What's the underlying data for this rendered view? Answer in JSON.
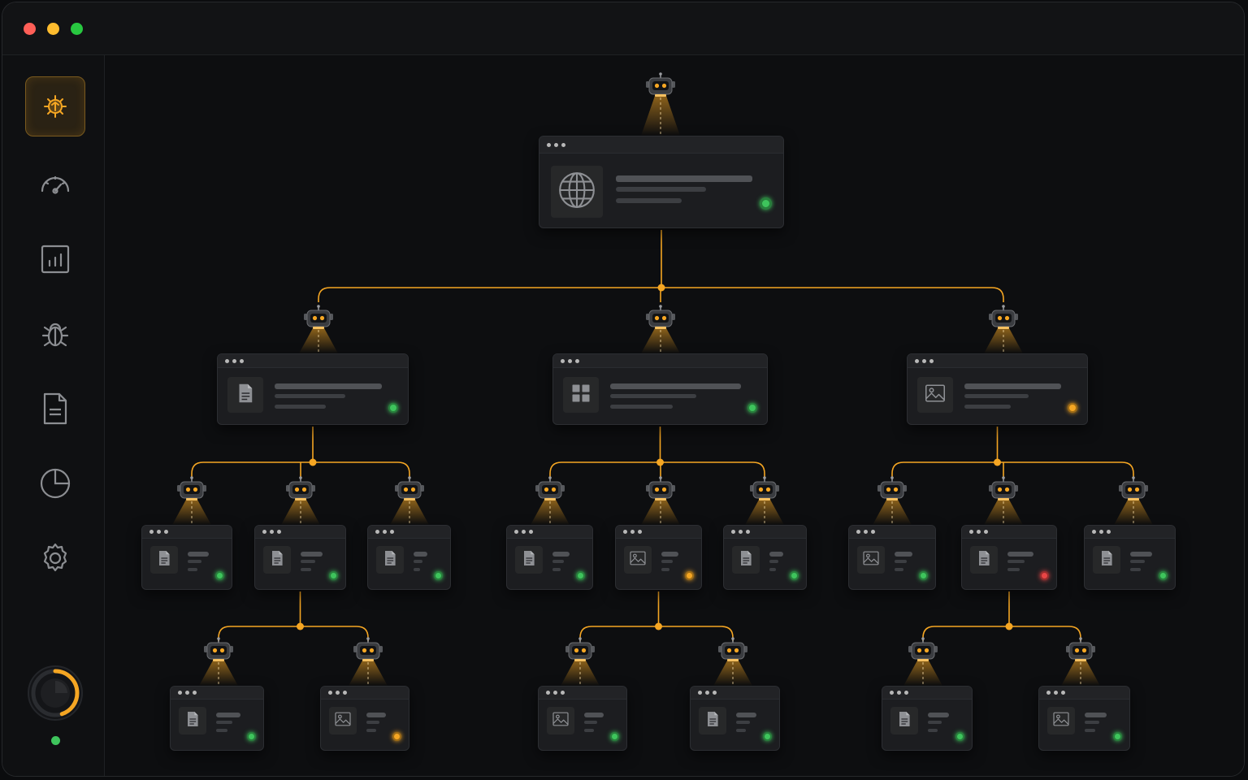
{
  "window": {
    "controls": [
      {
        "name": "close",
        "color": "#ff5f57"
      },
      {
        "name": "minimize",
        "color": "#febc2e"
      },
      {
        "name": "maximize",
        "color": "#28c840"
      }
    ]
  },
  "sidebar": {
    "items": [
      {
        "icon": "sitemap-bug-icon",
        "active": true
      },
      {
        "icon": "speedometer-icon",
        "active": false
      },
      {
        "icon": "bar-chart-icon",
        "active": false
      },
      {
        "icon": "bug-icon",
        "active": false
      },
      {
        "icon": "document-icon",
        "active": false
      },
      {
        "icon": "pie-chart-icon",
        "active": false
      },
      {
        "icon": "gear-icon",
        "active": false
      }
    ],
    "progress_ring": {
      "value": 0.45,
      "color": "#f5a623"
    },
    "status_dot_color": "#3ec45c"
  },
  "colors": {
    "accent": "#f5a623",
    "status_ok": "#3ec45c",
    "status_warn": "#f5a623",
    "status_error": "#e84545"
  },
  "tree": {
    "id": "root",
    "icon": "globe-icon",
    "status": "ok",
    "children": [
      {
        "id": "n1",
        "icon": "document-icon",
        "status": "ok",
        "children": [
          {
            "id": "n1a",
            "icon": "document-icon",
            "status": "ok"
          },
          {
            "id": "n1b",
            "icon": "document-icon",
            "status": "ok",
            "children": [
              {
                "id": "n1b1",
                "icon": "document-icon",
                "status": "ok"
              },
              {
                "id": "n1b2",
                "icon": "image-icon",
                "status": "warn"
              }
            ]
          },
          {
            "id": "n1c",
            "icon": "document-icon",
            "status": "ok"
          }
        ]
      },
      {
        "id": "n2",
        "icon": "grid-icon",
        "status": "ok",
        "children": [
          {
            "id": "n2a",
            "icon": "document-icon",
            "status": "ok"
          },
          {
            "id": "n2b",
            "icon": "image-icon",
            "status": "warn",
            "children": [
              {
                "id": "n2b1",
                "icon": "image-icon",
                "status": "ok"
              },
              {
                "id": "n2b2",
                "icon": "document-icon",
                "status": "ok"
              }
            ]
          },
          {
            "id": "n2c",
            "icon": "document-icon",
            "status": "ok"
          }
        ]
      },
      {
        "id": "n3",
        "icon": "image-icon",
        "status": "warn",
        "children": [
          {
            "id": "n3a",
            "icon": "image-icon",
            "status": "ok"
          },
          {
            "id": "n3b",
            "icon": "document-icon",
            "status": "error",
            "children": [
              {
                "id": "n3b1",
                "icon": "document-icon",
                "status": "ok"
              },
              {
                "id": "n3b2",
                "icon": "image-icon",
                "status": "ok"
              }
            ]
          },
          {
            "id": "n3c",
            "icon": "document-icon",
            "status": "ok"
          }
        ]
      }
    ]
  }
}
